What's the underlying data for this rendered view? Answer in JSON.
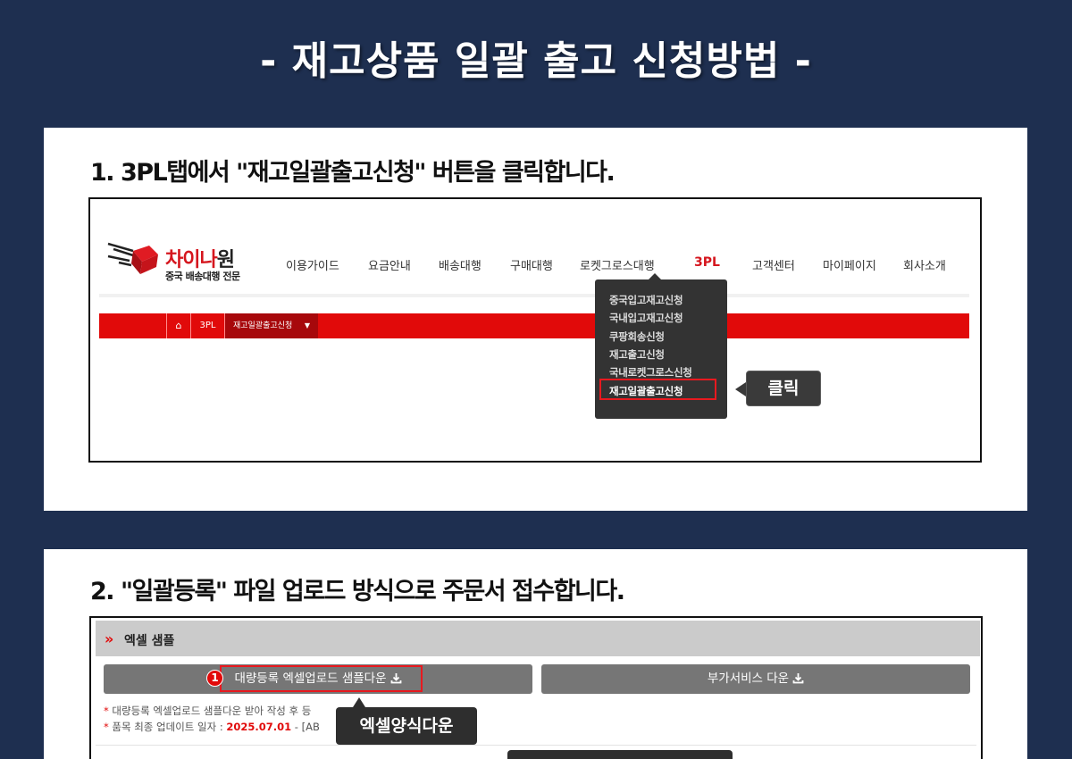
{
  "page_title": "- 재고상품 일괄 출고 신청방법 -",
  "step1": {
    "title": "1. 3PL탭에서 \"재고일괄출고신청\" 버튼을 클릭합니다.",
    "logo": {
      "name_red": "차이나",
      "name_dark": "원",
      "sub": "중국 배송대행 전문"
    },
    "nav": [
      "이용가이드",
      "요금안내",
      "배송대행",
      "구매대행",
      "로켓그로스대행",
      "3PL",
      "고객센터",
      "마이페이지",
      "회사소개"
    ],
    "breadcrumb": {
      "home_icon": "home-icon",
      "level1": "3PL",
      "current": "재고일괄출고신청",
      "caret": "▼"
    },
    "dropdown": [
      "중국입고재고신청",
      "국내입고재고신청",
      "쿠팡회송신청",
      "재고출고신청",
      "국내로켓그로스신청",
      "재고일괄출고신청"
    ],
    "callout": "클릭",
    "colors": {
      "accent": "#e10a0a",
      "dropdown_bg": "#333333",
      "highlight_border": "#e8191f"
    }
  },
  "step2": {
    "title": "2. \"일괄등록\" 파일 업로드 방식으로 주문서 접수합니다.",
    "section_arrow": "»",
    "section_title": "엑셀 샘플",
    "button1": "대량등록 엑셀업로드 샘플다운",
    "button2": "부가서비스 다운",
    "marker_number": "1",
    "note1": {
      "star": "*",
      "text": "대량등록 엑셀업로드 샘플다운 받아 작성 후 등"
    },
    "note2": {
      "star": "*",
      "prefix": "품목 최종 업데이트 일자 : ",
      "date": "2025.07.01",
      "suffix": " - [AB"
    },
    "callout": "엑셀양식다운",
    "download_icon": "download-icon"
  },
  "colors": {
    "page_bg": "#1e2f50",
    "card_bg": "#ffffff",
    "button_gray": "#767676"
  }
}
